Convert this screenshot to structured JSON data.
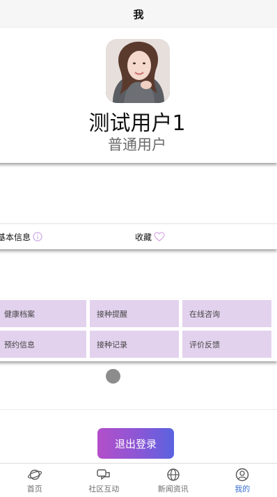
{
  "header": {
    "title": "我"
  },
  "profile": {
    "name": "测试用户1",
    "role": "普通用户"
  },
  "info_row": {
    "basic_label": "基本信息",
    "favorite_label": "收藏"
  },
  "services": [
    {
      "label": "健康档案"
    },
    {
      "label": "接种提醒"
    },
    {
      "label": "在线咨询"
    },
    {
      "label": "预约信息"
    },
    {
      "label": "接种记录"
    },
    {
      "label": "评价反馈"
    }
  ],
  "logout_label": "退出登录",
  "tabs": [
    {
      "label": "首页",
      "icon": "planet-icon"
    },
    {
      "label": "社区互动",
      "icon": "chat-icon"
    },
    {
      "label": "新闻资讯",
      "icon": "globe-icon"
    },
    {
      "label": "我的",
      "icon": "user-icon",
      "active": true
    }
  ],
  "colors": {
    "accent": "#3b6fd3",
    "grid_cell": "#e3d2ee",
    "heart": "#d8a9e6",
    "info_icon": "#c9a4e6"
  }
}
